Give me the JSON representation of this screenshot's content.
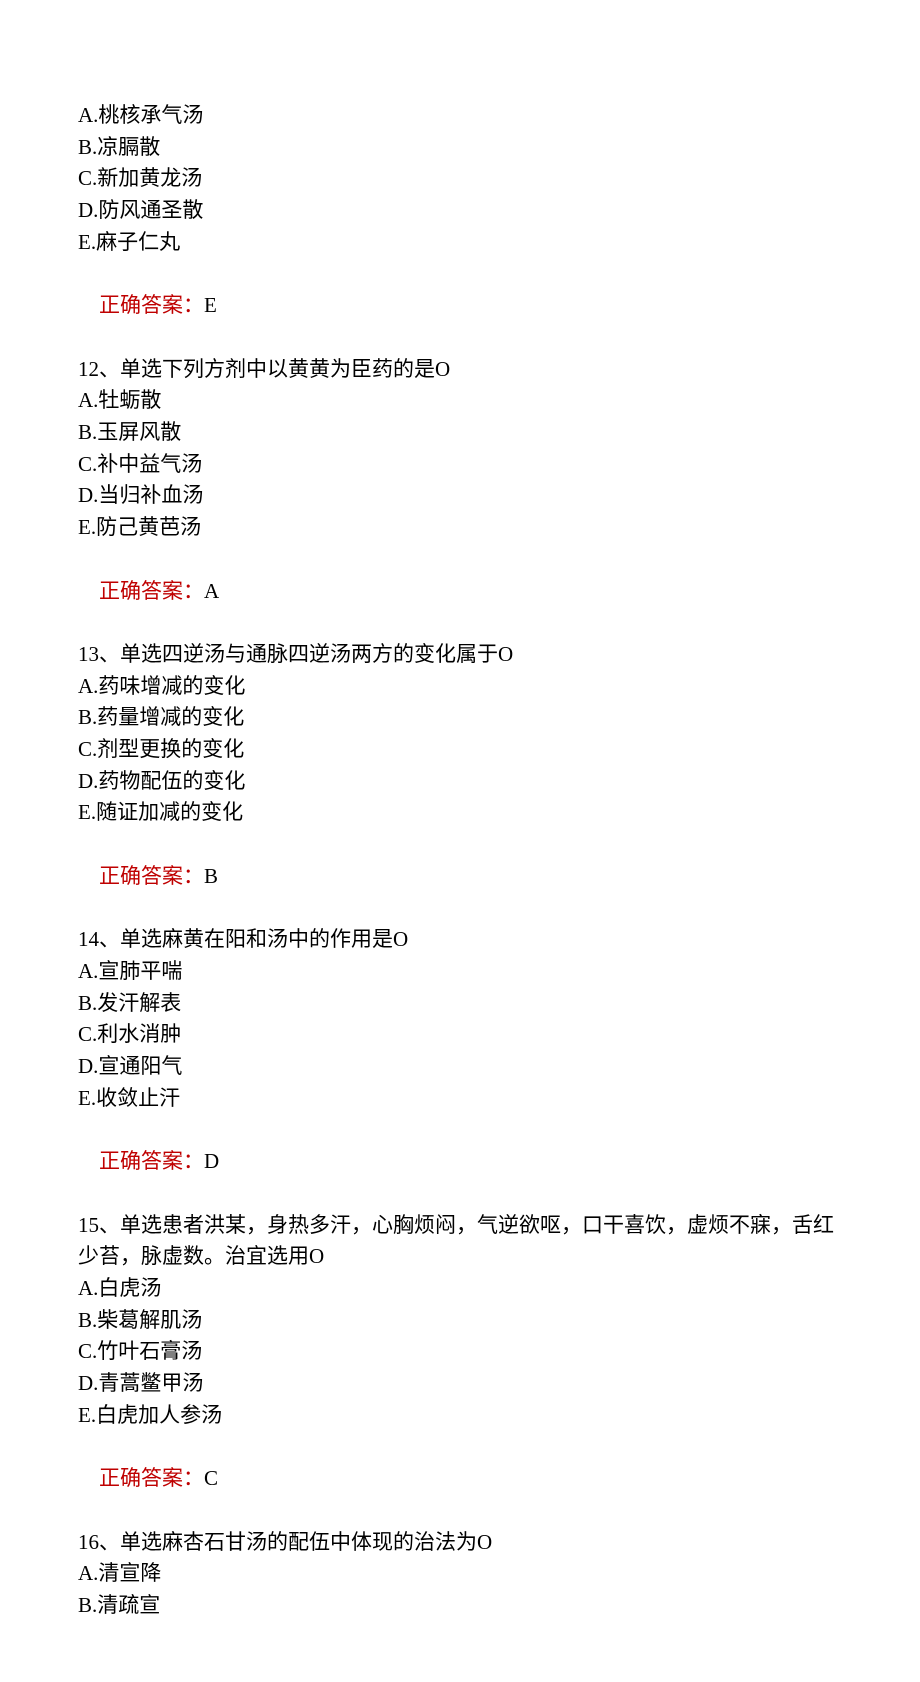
{
  "q11": {
    "options": {
      "A": "A.桃核承气汤",
      "B": "B.凉膈散",
      "C": "C.新加黄龙汤",
      "D": "D.防风通圣散",
      "E": "E.麻子仁丸"
    },
    "answer_label": "正确答案：",
    "answer_value": "E"
  },
  "q12": {
    "stem": "12、单选下列方剂中以黄黄为臣药的是O",
    "options": {
      "A": "A.牡蛎散",
      "B": "B.玉屏风散",
      "C": "C.补中益气汤",
      "D": "D.当归补血汤",
      "E": "E.防己黄芭汤"
    },
    "answer_label": "正确答案：",
    "answer_value": "A"
  },
  "q13": {
    "stem": "13、单选四逆汤与通脉四逆汤两方的变化属于O",
    "options": {
      "A": "A.药味增减的变化",
      "B": "B.药量增减的变化",
      "C": "C.剂型更换的变化",
      "D": "D.药物配伍的变化",
      "E": "E.随证加减的变化"
    },
    "answer_label": "正确答案：",
    "answer_value": "B"
  },
  "q14": {
    "stem": "14、单选麻黄在阳和汤中的作用是O",
    "options": {
      "A": "A.宣肺平喘",
      "B": "B.发汗解表",
      "C": "C.利水消肿",
      "D": "D.宣通阳气",
      "E": "E.收敛止汗"
    },
    "answer_label": "正确答案：",
    "answer_value": "D"
  },
  "q15": {
    "stem": "15、单选患者洪某，身热多汗，心胸烦闷，气逆欲呕，口干喜饮，虚烦不寐，舌红少苔，脉虚数。治宜选用O",
    "options": {
      "A": "A.白虎汤",
      "B": "B.柴葛解肌汤",
      "C": "C.竹叶石膏汤",
      "D": "D.青蒿鳖甲汤",
      "E": "E.白虎加人参汤"
    },
    "answer_label": "正确答案：",
    "answer_value": "C"
  },
  "q16": {
    "stem": "16、单选麻杏石甘汤的配伍中体现的治法为O",
    "options": {
      "A": "A.清宣降",
      "B": "B.清疏宣"
    }
  }
}
